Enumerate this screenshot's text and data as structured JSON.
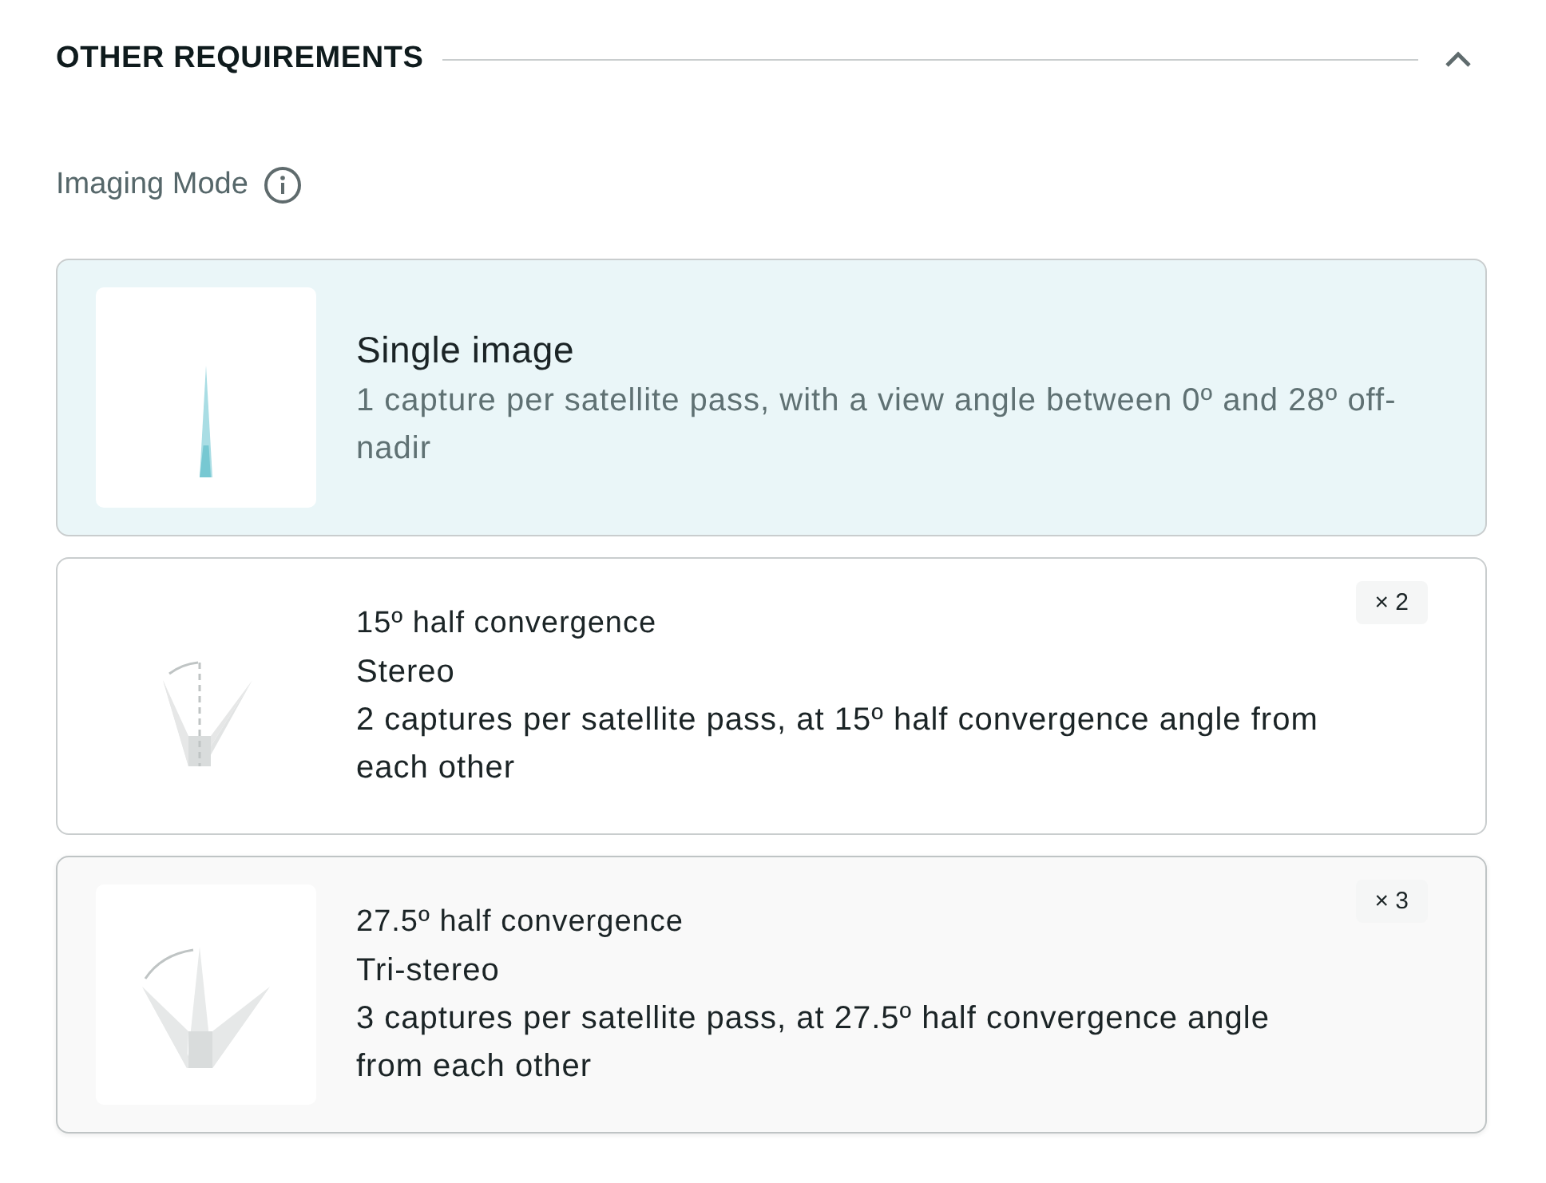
{
  "section": {
    "title": "OTHER REQUIREMENTS",
    "expanded": true
  },
  "field": {
    "label": "Imaging Mode"
  },
  "options": [
    {
      "kind": "single",
      "selected": true,
      "hovered": false,
      "title": "Single image",
      "description": "1 capture per satellite pass, with a view angle between 0º and 28º off-nadir"
    },
    {
      "kind": "stereo",
      "selected": false,
      "hovered": false,
      "subtitle": "15º half convergence",
      "title": "Stereo",
      "description": "2 captures per satellite pass, at 15º half convergence angle from each other",
      "badge": "× 2"
    },
    {
      "kind": "tristereo",
      "selected": false,
      "hovered": true,
      "subtitle": "27.5º half convergence",
      "title": "Tri-stereo",
      "description": "3 captures per satellite pass, at 27.5º half convergence angle from each other",
      "badge": "× 3"
    }
  ]
}
